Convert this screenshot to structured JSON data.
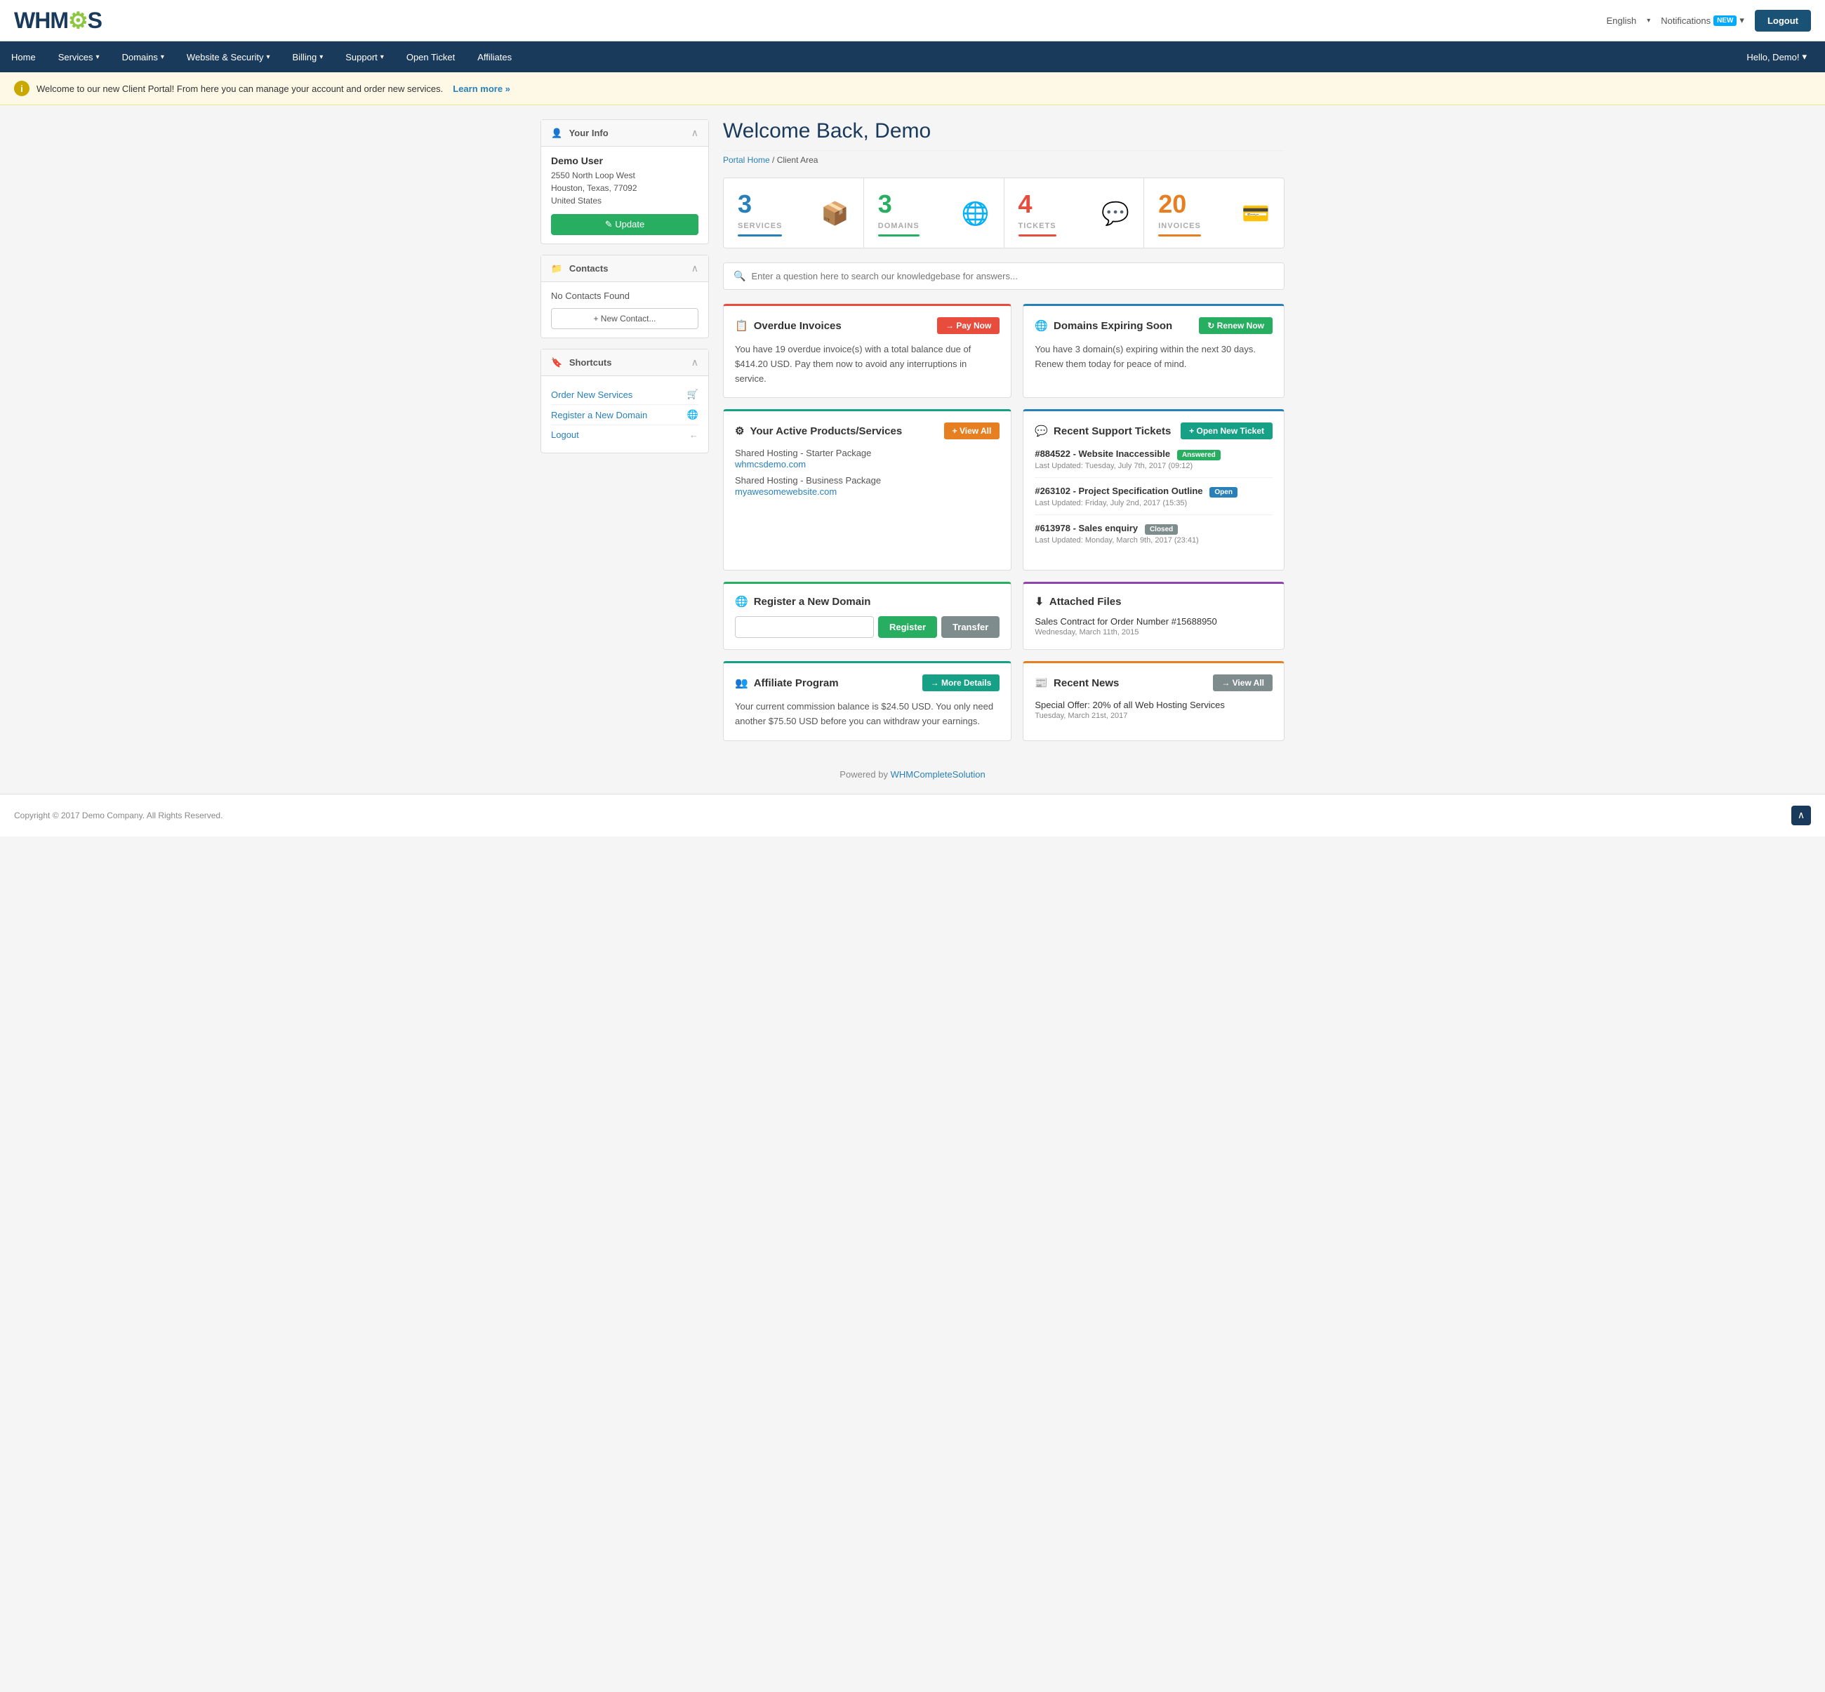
{
  "header": {
    "logo_text": "WHMC",
    "logo_gear": "⚙",
    "logo_s": "S",
    "lang_label": "English",
    "notif_label": "Notifications",
    "notif_badge": "NEW",
    "logout_label": "Logout"
  },
  "nav": {
    "items": [
      {
        "label": "Home",
        "id": "home"
      },
      {
        "label": "Services",
        "id": "services",
        "has_arrow": true
      },
      {
        "label": "Domains",
        "id": "domains",
        "has_arrow": true
      },
      {
        "label": "Website & Security",
        "id": "websecurity",
        "has_arrow": true
      },
      {
        "label": "Billing",
        "id": "billing",
        "has_arrow": true
      },
      {
        "label": "Support",
        "id": "support",
        "has_arrow": true
      },
      {
        "label": "Open Ticket",
        "id": "openticket"
      },
      {
        "label": "Affiliates",
        "id": "affiliates"
      }
    ],
    "hello_label": "Hello, Demo!",
    "hello_arrow": "▾"
  },
  "banner": {
    "text": "Welcome to our new Client Portal! From here you can manage your account and order new services.",
    "link_text": "Learn more »"
  },
  "sidebar": {
    "your_info": {
      "title": "Your Info",
      "name": "Demo User",
      "address_line1": "2550 North Loop West",
      "address_line2": "Houston, Texas, 77092",
      "address_line3": "United States",
      "update_label": "✎ Update"
    },
    "contacts": {
      "title": "Contacts",
      "no_contacts": "No Contacts Found",
      "new_contact_label": "+ New Contact..."
    },
    "shortcuts": {
      "title": "Shortcuts",
      "items": [
        {
          "label": "Order New Services",
          "icon": "🛒"
        },
        {
          "label": "Register a New Domain",
          "icon": "🌐"
        },
        {
          "label": "Logout",
          "icon": "←"
        }
      ]
    }
  },
  "main": {
    "welcome_title": "Welcome Back, Demo",
    "breadcrumb_home": "Portal Home",
    "breadcrumb_current": "Client Area",
    "stats": [
      {
        "number": "3",
        "label": "SERVICES",
        "bar_class": "bar-blue"
      },
      {
        "number": "3",
        "label": "DOMAINS",
        "bar_class": "bar-green"
      },
      {
        "number": "4",
        "label": "TICKETS",
        "bar_class": "bar-red"
      },
      {
        "number": "20",
        "label": "INVOICES",
        "bar_class": "bar-orange"
      }
    ],
    "search_placeholder": "Enter a question here to search our knowledgebase for answers...",
    "overdue_invoices": {
      "title": "Overdue Invoices",
      "btn_label": "→ Pay Now",
      "text": "You have 19 overdue invoice(s) with a total balance due of $414.20 USD. Pay them now to avoid any interruptions in service."
    },
    "domains_expiring": {
      "title": "Domains Expiring Soon",
      "btn_label": "↻ Renew Now",
      "text": "You have 3 domain(s) expiring within the next 30 days. Renew them today for peace of mind."
    },
    "active_products": {
      "title": "Your Active Products/Services",
      "btn_label": "+ View All",
      "services": [
        {
          "name": "Shared Hosting - Starter Package",
          "url": "whmcsdemo.com"
        },
        {
          "name": "Shared Hosting - Business Package",
          "url": "myawesomewebsite.com"
        }
      ]
    },
    "support_tickets": {
      "title": "Recent Support Tickets",
      "btn_label": "+ Open New Ticket",
      "tickets": [
        {
          "id": "#884522",
          "desc": "Website Inaccessible",
          "status": "Answered",
          "status_class": "status-answered",
          "date": "Last Updated: Tuesday, July 7th, 2017 (09:12)"
        },
        {
          "id": "#263102",
          "desc": "Project Specification Outline",
          "status": "Open",
          "status_class": "status-open",
          "date": "Last Updated: Friday, July 2nd, 2017 (15:35)"
        },
        {
          "id": "#613978",
          "desc": "Sales enquiry",
          "status": "Closed",
          "status_class": "status-closed",
          "date": "Last Updated: Monday, March 9th, 2017 (23:41)"
        }
      ]
    },
    "register_domain": {
      "title": "Register a New Domain",
      "register_label": "Register",
      "transfer_label": "Transfer"
    },
    "affiliate": {
      "title": "Affiliate Program",
      "btn_label": "→ More Details",
      "text": "Your current commission balance is $24.50 USD. You only need another $75.50 USD before you can withdraw your earnings."
    },
    "attached_files": {
      "title": "Attached Files",
      "file_name": "Sales Contract for Order Number #15688950",
      "file_date": "Wednesday, March 11th, 2015"
    },
    "recent_news": {
      "title": "Recent News",
      "btn_label": "→ View All",
      "news_title": "Special Offer: 20% of all Web Hosting Services",
      "news_date": "Tuesday, March 21st, 2017"
    }
  },
  "footer": {
    "powered_by": "Powered by",
    "powered_link": "WHMCompleteSolution",
    "copyright": "Copyright © 2017 Demo Company. All Rights Reserved."
  }
}
